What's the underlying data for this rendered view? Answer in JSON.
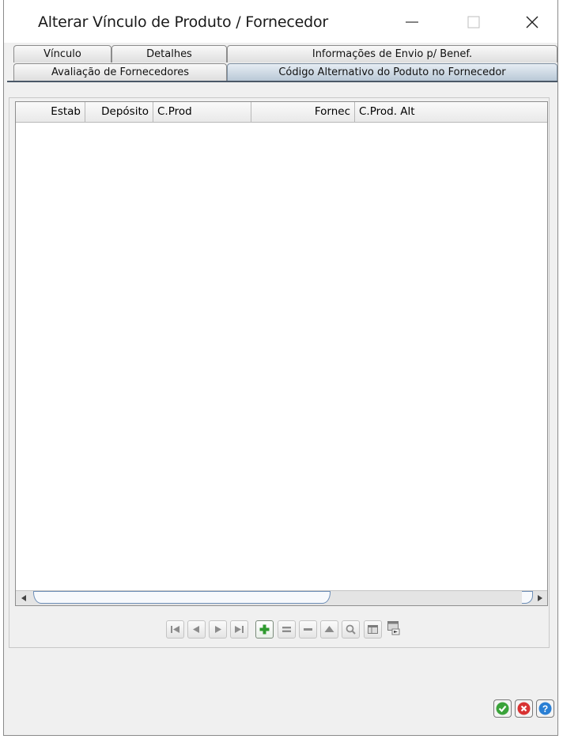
{
  "window": {
    "title": "Alterar Vínculo de Produto / Fornecedor",
    "controls": [
      "minimize-icon",
      "maximize-icon",
      "close-icon"
    ]
  },
  "tabs": {
    "row1": [
      "Vínculo",
      "Detalhes",
      "Informações de Envio p/ Benef."
    ],
    "row2": [
      "Avaliação de Fornecedores",
      "Código Alternativo do Poduto no Fornecedor"
    ],
    "active": "Código Alternativo do Poduto no Fornecedor"
  },
  "grid": {
    "columns": [
      "Estab",
      "Depósito",
      "C.Prod",
      "Fornec",
      "C.Prod. Alt"
    ],
    "rows": []
  },
  "navigation": {
    "buttons": [
      "first-icon",
      "previous-icon",
      "next-icon",
      "last-icon",
      "add-icon",
      "copy-icon",
      "remove-icon",
      "up-icon",
      "search-icon",
      "detail-icon",
      "export-icon"
    ],
    "active": "add-icon"
  },
  "actions": [
    "ok-icon",
    "cancel-icon",
    "help-icon"
  ],
  "colors": {
    "active_tab": "#b9c8d6",
    "ok": "#3aa33a",
    "cancel": "#d83232",
    "help": "#2a7fd4",
    "add": "#2e9a2e"
  }
}
